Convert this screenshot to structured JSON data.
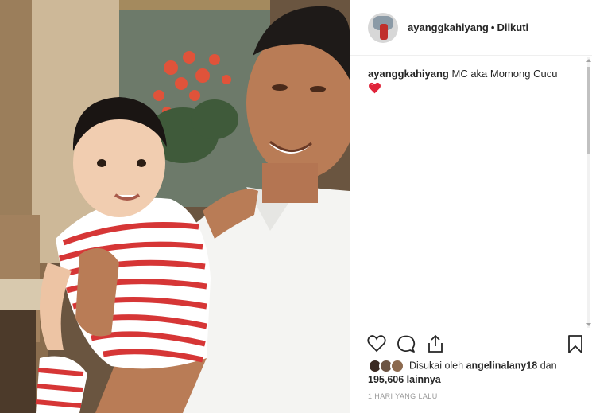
{
  "header": {
    "username": "ayanggkahiyang",
    "separator": "•",
    "follow_status": "Diikuti"
  },
  "caption": {
    "username": "ayanggkahiyang",
    "text": "MC aka Momong Cucu",
    "emoji": "red-heart"
  },
  "actions": {
    "icons": [
      "heart-icon",
      "comment-icon",
      "share-icon",
      "bookmark-icon"
    ]
  },
  "likes": {
    "prefix": "Disukai oleh",
    "liked_by_user": "angelinalany18",
    "joiner": "dan",
    "others_count": "195,606 lainnya"
  },
  "timestamp": "1 HARI YANG LALU",
  "colors": {
    "heart_emoji": "#e0243a",
    "meta_text": "#999999",
    "divider": "#efefef"
  }
}
